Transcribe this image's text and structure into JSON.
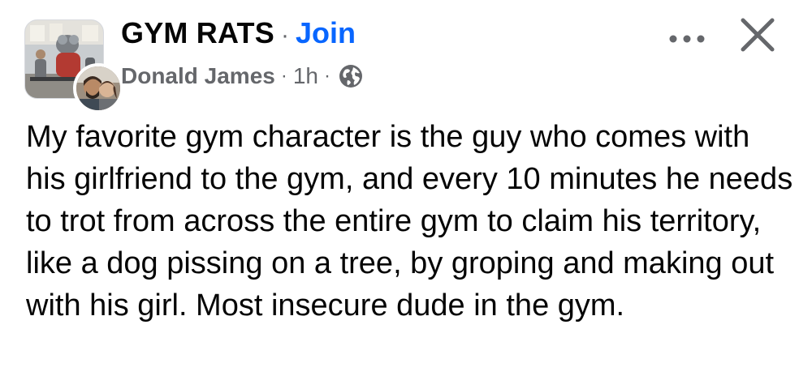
{
  "post": {
    "group_name": "GYM RATS",
    "separator": "·",
    "join_label": "Join",
    "author_name": "Donald James",
    "time_ago": "1h",
    "privacy_icon": "globe-icon",
    "more_icon": "more-options-icon",
    "close_icon": "close-icon",
    "text": "My favorite gym character is the guy who comes with his girlfriend to the gym, and every 10 minutes he needs to trot from across the entire gym to claim his territory, like a dog pissing on a tree, by groping and making out with his girl. Most insecure dude in the gym."
  },
  "colors": {
    "link_blue": "#0866ff",
    "secondary_text": "#65676b",
    "primary_text": "#050505"
  }
}
